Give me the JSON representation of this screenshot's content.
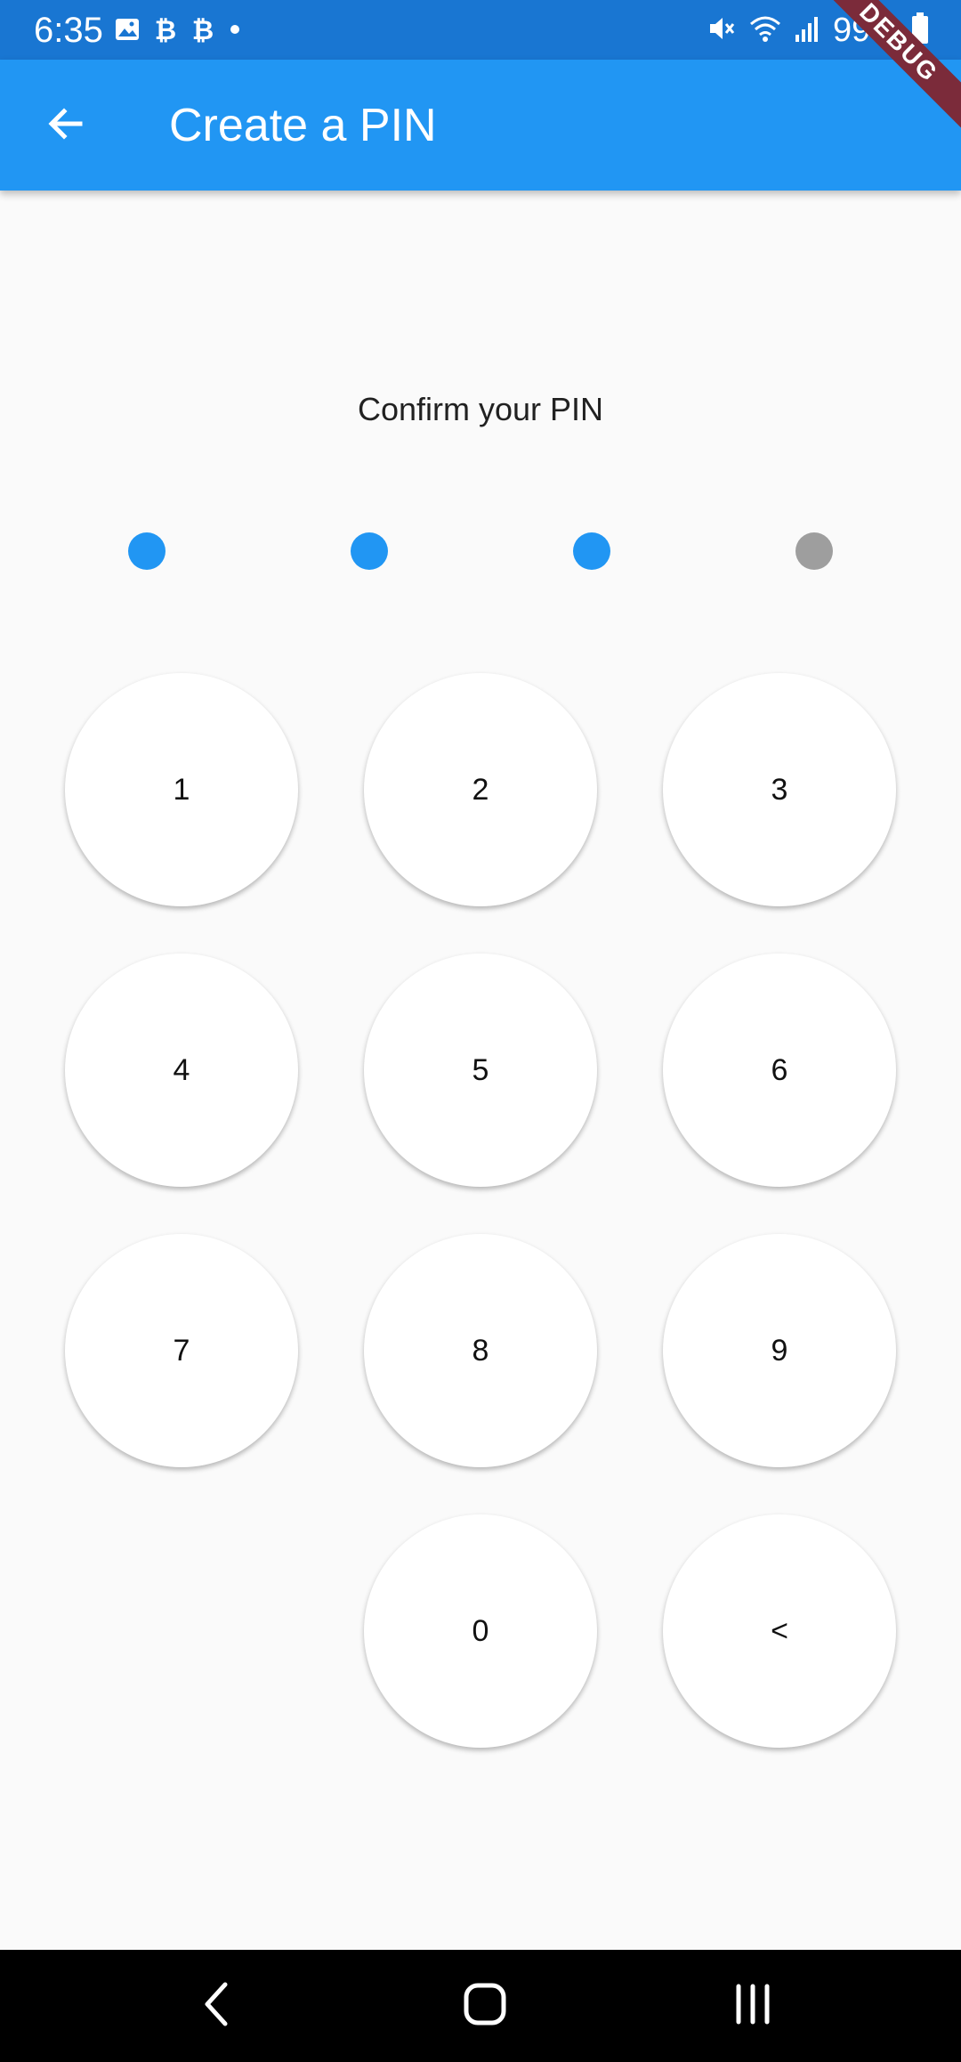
{
  "status_bar": {
    "time": "6:35",
    "left_icons": [
      "image-icon",
      "bitcoin-icon",
      "bitcoin-icon",
      "dot-icon"
    ],
    "right_icons": [
      "mute-icon",
      "wifi-icon",
      "signal-icon",
      "battery-icon"
    ],
    "battery": "99%"
  },
  "debug_banner": "DEBUG",
  "app_bar": {
    "back_icon": "arrow-back-icon",
    "title": "Create a PIN",
    "color": "#2196f3"
  },
  "prompt": "Confirm your PIN",
  "pin": {
    "length": 4,
    "filled": 3,
    "filled_color": "#2196f3",
    "empty_color": "#9e9e9e"
  },
  "keypad": {
    "keys": [
      "1",
      "2",
      "3",
      "4",
      "5",
      "6",
      "7",
      "8",
      "9",
      "0",
      "<"
    ]
  },
  "nav_bar": {
    "icons": [
      "nav-back-icon",
      "nav-home-icon",
      "nav-recents-icon"
    ]
  }
}
